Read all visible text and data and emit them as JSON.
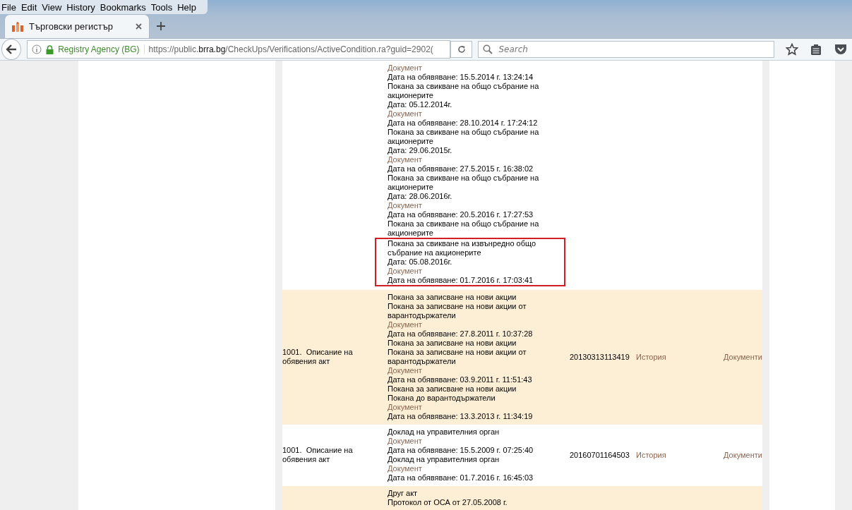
{
  "menu": [
    "File",
    "Edit",
    "View",
    "History",
    "Bookmarks",
    "Tools",
    "Help"
  ],
  "tabs": [
    {
      "title": "Търговски регистър",
      "selected": true
    }
  ],
  "address": {
    "identity": "Registry Agency (BG)",
    "url_prefix": "https://public.",
    "url_domain": "brra.bg",
    "url_path": "/CheckUps/Verifications/ActiveCondition.ra?guid=2902("
  },
  "search": {
    "placeholder": "Search"
  },
  "rows": [
    {
      "shaded": false,
      "description": [],
      "code": "",
      "history": "",
      "documents": "",
      "lines": [
        {
          "kind": "link",
          "text": "Документ",
          "highlighted": false
        },
        {
          "kind": "text",
          "text": "Дата на обявяване: 15.5.2014 г. 13:24:14",
          "highlighted": false
        },
        {
          "kind": "text",
          "text": "Покана за свикване на общо събрание на",
          "highlighted": false
        },
        {
          "kind": "text",
          "text": "акционерите",
          "highlighted": false
        },
        {
          "kind": "text",
          "text": "Дата: 05.12.2014г.",
          "highlighted": false
        },
        {
          "kind": "link",
          "text": "Документ",
          "highlighted": false
        },
        {
          "kind": "text",
          "text": "Дата на обявяване: 28.10.2014 г. 17:24:12",
          "highlighted": false
        },
        {
          "kind": "text",
          "text": "Покана за свикване на общо събрание на",
          "highlighted": false
        },
        {
          "kind": "text",
          "text": "акционерите",
          "highlighted": false
        },
        {
          "kind": "text",
          "text": "Дата: 29.06.2015г.",
          "highlighted": false
        },
        {
          "kind": "link",
          "text": "Документ",
          "highlighted": false
        },
        {
          "kind": "text",
          "text": "Дата на обявяване: 27.5.2015 г. 16:38:02",
          "highlighted": false
        },
        {
          "kind": "text",
          "text": "Покана за свикване на общо събрание на",
          "highlighted": false
        },
        {
          "kind": "text",
          "text": "акционерите",
          "highlighted": false
        },
        {
          "kind": "text",
          "text": "Дата: 28.06.2016г.",
          "highlighted": false
        },
        {
          "kind": "link",
          "text": "Документ",
          "highlighted": false
        },
        {
          "kind": "text",
          "text": "Дата на обявяване: 20.5.2016 г. 17:27:53",
          "highlighted": false
        },
        {
          "kind": "text",
          "text": "Покана за свикване на общо събрание на",
          "highlighted": false
        },
        {
          "kind": "text",
          "text": "акционерите",
          "highlighted": false
        },
        {
          "kind": "text",
          "text": "Покана за свикване на извънредно общо",
          "highlighted": true
        },
        {
          "kind": "text",
          "text": "събрание на акционерите",
          "highlighted": true
        },
        {
          "kind": "text",
          "text": "Дата: 05.08.2016г.",
          "highlighted": true
        },
        {
          "kind": "link",
          "text": "Документ",
          "highlighted": true
        },
        {
          "kind": "text",
          "text": "Дата на обявяване: 01.7.2016 г. 17:03:41",
          "highlighted": true
        }
      ]
    },
    {
      "shaded": true,
      "description": [
        "1001.  Описание на",
        "обявения акт"
      ],
      "code": "20130313113419",
      "history": "История",
      "documents": "Документи",
      "lines": [
        {
          "kind": "text",
          "text": "Покана за записване на нови акции",
          "highlighted": false
        },
        {
          "kind": "text",
          "text": "Покана за записване на нови акции от",
          "highlighted": false
        },
        {
          "kind": "text",
          "text": "варантодържатели",
          "highlighted": false
        },
        {
          "kind": "link",
          "text": "Документ",
          "highlighted": false
        },
        {
          "kind": "text",
          "text": "Дата на обявяване: 27.8.2011 г. 10:37:28",
          "highlighted": false
        },
        {
          "kind": "text",
          "text": "Покана за записване на нови акции",
          "highlighted": false
        },
        {
          "kind": "text",
          "text": "Покана за записване на нови акции от",
          "highlighted": false
        },
        {
          "kind": "text",
          "text": "варантодържатели",
          "highlighted": false
        },
        {
          "kind": "link",
          "text": "Документ",
          "highlighted": false
        },
        {
          "kind": "text",
          "text": "Дата на обявяване: 03.9.2011 г. 11:51:43",
          "highlighted": false
        },
        {
          "kind": "text",
          "text": "Покана за записване на нови акции",
          "highlighted": false
        },
        {
          "kind": "text",
          "text": "Покана до варантодържатели",
          "highlighted": false
        },
        {
          "kind": "link",
          "text": "Документ",
          "highlighted": false
        },
        {
          "kind": "text",
          "text": "Дата на обявяване: 13.3.2013 г. 11:34:19",
          "highlighted": false
        }
      ]
    },
    {
      "shaded": false,
      "description": [
        "1001.  Описание на",
        "обявения акт"
      ],
      "code": "20160701164503",
      "history": "История",
      "documents": "Документи",
      "lines": [
        {
          "kind": "text",
          "text": "Доклад на управителния орган",
          "highlighted": false
        },
        {
          "kind": "link",
          "text": "Документ",
          "highlighted": false
        },
        {
          "kind": "text",
          "text": "Дата на обявяване: 15.5.2009 г. 07:25:40",
          "highlighted": false
        },
        {
          "kind": "text",
          "text": "Доклад на управителния орган",
          "highlighted": false
        },
        {
          "kind": "link",
          "text": "Документ",
          "highlighted": false
        },
        {
          "kind": "text",
          "text": "Дата на обявяване: 01.7.2016 г. 16:45:03",
          "highlighted": false
        }
      ]
    },
    {
      "shaded": true,
      "description": [],
      "code": "",
      "history": "",
      "documents": "",
      "lines": [
        {
          "kind": "text",
          "text": "Друг акт",
          "highlighted": false
        },
        {
          "kind": "text",
          "text": "Протокол от ОСА от 27.05.2008 г.",
          "highlighted": false
        }
      ]
    }
  ]
}
